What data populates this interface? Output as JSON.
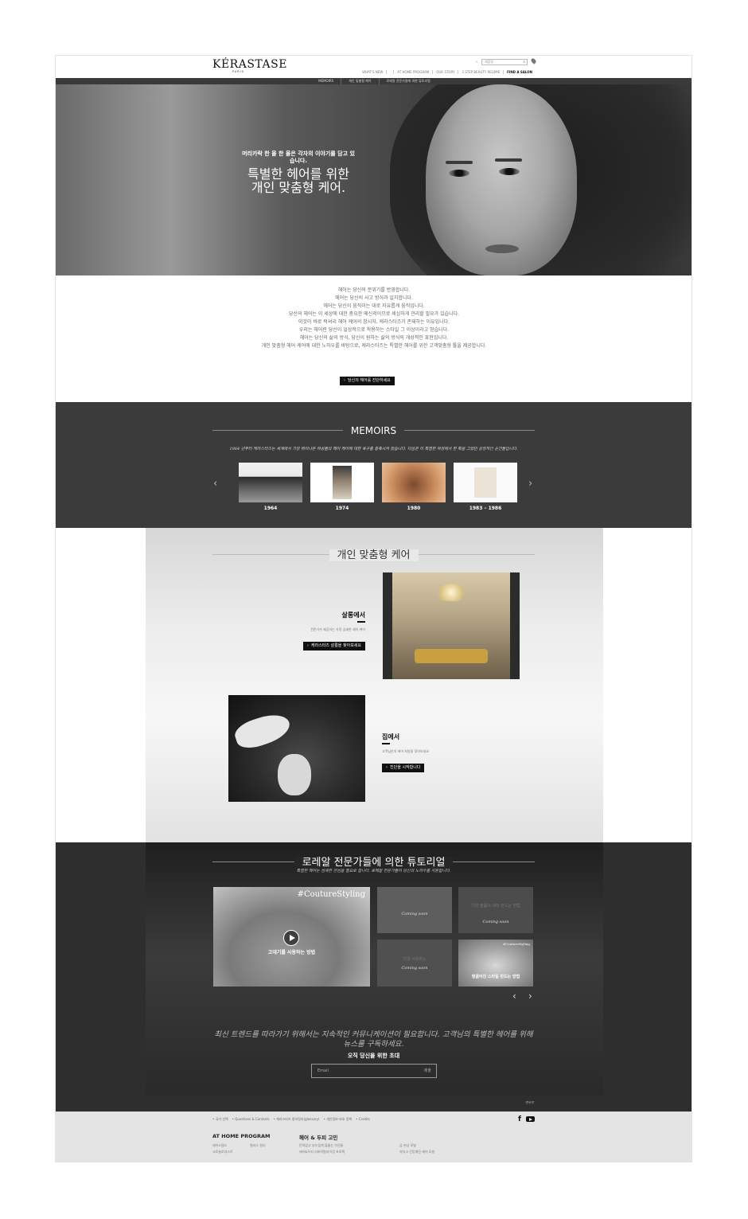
{
  "header": {
    "logo": "KÉRASTASE",
    "logo_sub": "PARIS",
    "lang": "‹",
    "search_placeholder": "제품명",
    "nav": [
      "WHAT'S NEW",
      "",
      "AT HOME PROGRAM",
      "OUR STORY",
      "3 STEP BEAUTY REGIME",
      "FIND A SALON"
    ]
  },
  "subnav": [
    "MEMOIRS",
    "개인 맞춤형 케어",
    "로레알 전문가들에 의한 튜토리얼"
  ],
  "hero": {
    "kicker": "머리카락 한 올 한 올은 각자의 이야기를 담고 있습니다.",
    "title": "특별한 헤어를 위한 개인 맞춤형 케어."
  },
  "intro": {
    "lines": [
      "헤어는 당신의 분위기를 반영합니다.",
      "헤어는 당신의 사고 방식과 일치합니다.",
      "헤어는 당신이 움직이는 대로 자유롭게 움직입니다.",
      "당신의 헤어는 이 세상에 대한 중요한 메신저이므로 세심하게 관리할 필요가 있습니다.",
      "이것이 바로 럭셔리 헤어 케어의 창시자, 케라스타즈가 존재하는 이유입니다.",
      "우리는 헤어란 당신이 일상적으로 착용하는 스타일 그 이상이라고 믿습니다.",
      "헤어는 당신의 삶의 방식, 당신이 원하는 삶의 방식의 개성적인 표현입니다.",
      "개인 맞춤형 헤어 케어에 대한 노하우를 바탕으로, 케라스타즈는 특별한 헤어를 위한 고객맞춤형 툴을 제공합니다."
    ],
    "button": "당신의 헤어를 진단하세요"
  },
  "memoirs": {
    "title": "MEMOIRS",
    "text": "1964 년부터 케라스타즈는 세계에서 가장 뛰어나온 여성들의 헤어 케어에 대한 욕구를 충족시켜 왔습니다. 다음은 이 특별한 여정에서 한 획을 그었던 상징적인 순간들입니다.",
    "items": [
      {
        "year": "1964"
      },
      {
        "year": "1974"
      },
      {
        "year": "1980"
      },
      {
        "year": "1983 – 1986"
      }
    ]
  },
  "care": {
    "title": "개인 맞춤형 케어",
    "salon": {
      "heading": "살롱에서",
      "text": "전문가가 제공하는 가장 섬세한 헤어 케어",
      "button": "케라스타즈 살롱을 찾아보세요"
    },
    "home": {
      "heading": "집에서",
      "text": "고객님만의 헤어 처방을 찾아보세요",
      "button": "진단을 시작합니다"
    }
  },
  "tutorial": {
    "title": "로레알 전문가들에 의한 튜토리얼",
    "subtitle": "특별한 헤어는 섬세한 관심을 필요로 합니다. 로레알 전문가들이 당신의 노하우를 지원합니다.",
    "main_tag": "#CoutureStyling",
    "main_caption": "고데기를 사용하는 방법",
    "coming_soon": "Coming soon",
    "tile_small_1": "다양 볼륨의 셰이 만드는 방법",
    "tile_small_2": "다양 사용하는",
    "tile_small_3_tag": "#CoutureStyling",
    "tile_small_3_caption": "헝클어진 스타일 만드는 방법",
    "newsletter": "최신 트렌드를 따라가기 위해서는 지속적인 커뮤니케이션이 필요합니다. 고객님의 특별한 헤어를 위해 뉴스를 구독하세요.",
    "invite": "오직 당신을 위한 초대",
    "email_placeholder": "Email",
    "email_button": "제출",
    "sign": "맨위로"
  },
  "footer": {
    "links": [
      "국가 선택",
      "Questions & Contacts",
      "케라스타즈 용어정리(glossary)",
      "개인정보 보호 정책",
      "Credits"
    ],
    "col1_title": "AT HOME PROGRAM",
    "col1_items": [
      "헤어스템스",
      "크로놀로지스트",
      "컬러스 릴리"
    ],
    "col2_title": "헤어 & 두피 고민",
    "col2_items": [
      "탄력있고 부드럽게 볼륨는 가진들",
      "헤어&두피 리바이탈라이징 프로젝",
      "곱 손상 모발",
      "약하고 건강해진 헤어 모발"
    ]
  },
  "colors": {
    "dark": "#3b3b3b",
    "accent": "#111111"
  }
}
